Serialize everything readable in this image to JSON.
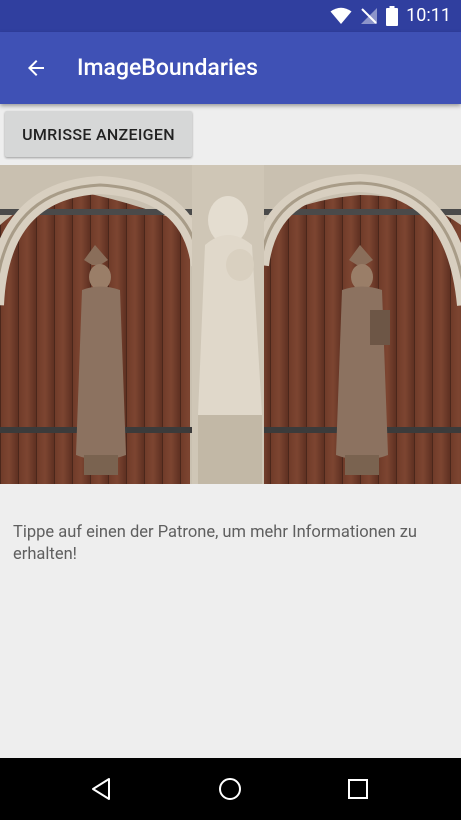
{
  "status_bar": {
    "time": "10:11",
    "icons": [
      "wifi-icon",
      "no-signal-icon",
      "battery-icon"
    ]
  },
  "app_bar": {
    "title": "ImageBoundaries",
    "back_icon": "arrow-back-icon"
  },
  "toggle_button": {
    "label": "UMRISSE ANZEIGEN"
  },
  "photo": {
    "description_icon": "church-portal-statues-image"
  },
  "instruction": {
    "text": "Tippe auf einen der Patrone, um mehr Informationen zu erhalten!"
  },
  "nav_bar": {
    "buttons": [
      "back-triangle-icon",
      "home-circle-icon",
      "recents-square-icon"
    ]
  },
  "colors": {
    "status_bar": "#303f9f",
    "app_bar": "#3f51b5",
    "background": "#eeeeee",
    "button": "#d6d7d7",
    "nav_bar": "#000000"
  }
}
